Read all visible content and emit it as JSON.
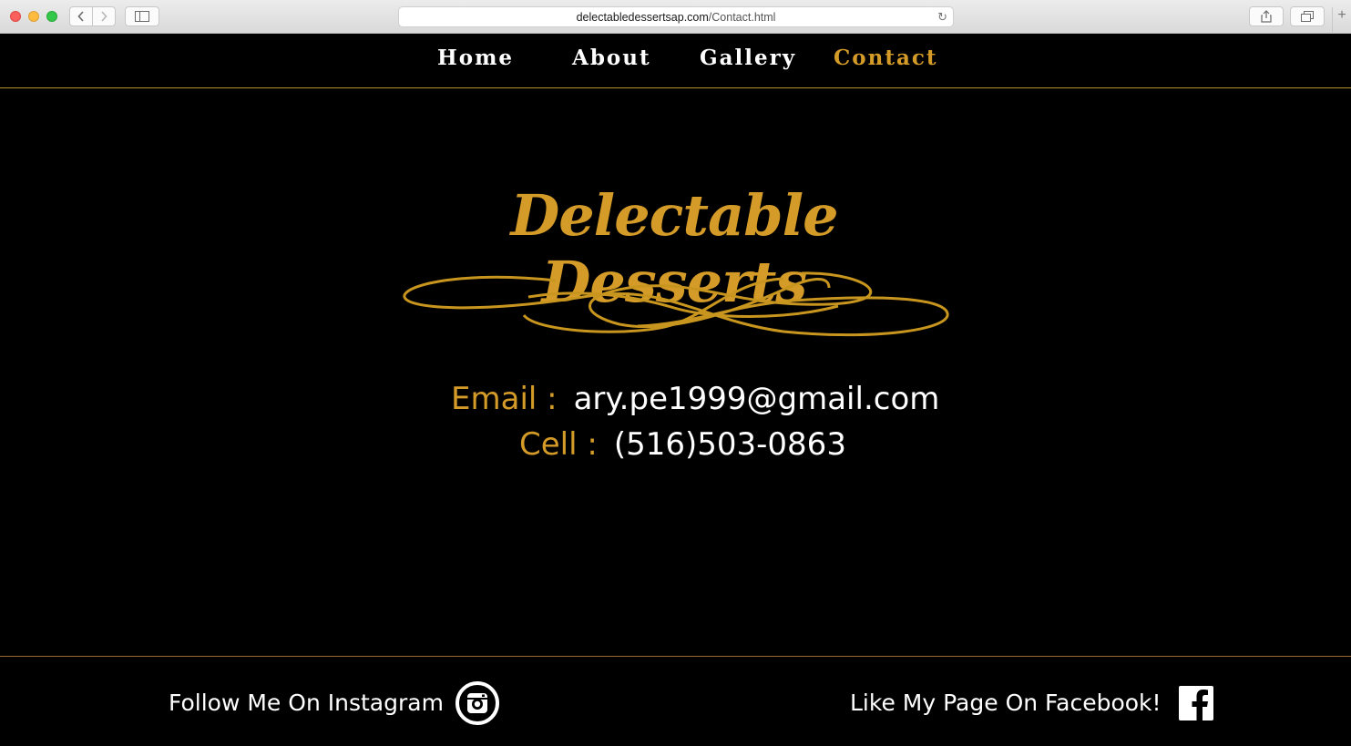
{
  "browser": {
    "url_host": "delectabledessertsap.com",
    "url_path": "/Contact.html"
  },
  "nav": {
    "items": [
      {
        "label": "Home",
        "active": false
      },
      {
        "label": "About",
        "active": false
      },
      {
        "label": "Gallery",
        "active": false
      },
      {
        "label": "Contact",
        "active": true
      }
    ]
  },
  "logo": {
    "title": "Delectable Desserts"
  },
  "contact": {
    "email_label": "Email :",
    "email_value": "ary.pe1999@gmail.com",
    "cell_label": "Cell :",
    "cell_value": "(516)503-0863"
  },
  "footer": {
    "instagram_text": "Follow Me On Instagram",
    "facebook_text": "Like My Page On Facebook!"
  },
  "colors": {
    "accent": "#d49b28",
    "background": "#000000",
    "text": "#ffffff"
  }
}
